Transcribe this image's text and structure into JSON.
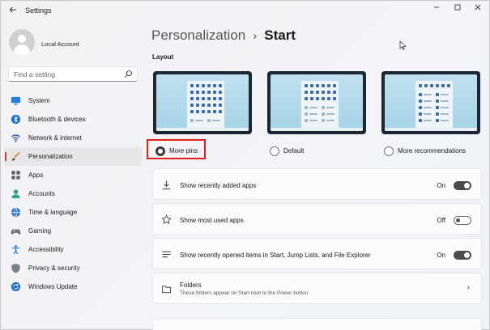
{
  "window": {
    "title": "Settings"
  },
  "titlebar": {
    "back_icon": "back-arrow-icon",
    "minimize": "minimize-icon",
    "maximize": "maximize-icon",
    "close": "close-icon"
  },
  "account": {
    "name": "Local Account"
  },
  "search": {
    "placeholder": "Find a setting"
  },
  "sidebar": {
    "items": [
      {
        "label": "System",
        "icon": "monitor-icon",
        "color": "#2b7bd3"
      },
      {
        "label": "Bluetooth & devices",
        "icon": "bluetooth-icon",
        "color": "#1e73c8"
      },
      {
        "label": "Network & internet",
        "icon": "wifi-icon",
        "color": "#2b5aa0"
      },
      {
        "label": "Personalization",
        "icon": "paintbrush-icon",
        "color": "#d08a3c",
        "active": true
      },
      {
        "label": "Apps",
        "icon": "apps-icon",
        "color": "#555a66"
      },
      {
        "label": "Accounts",
        "icon": "person-icon",
        "color": "#2aa38a"
      },
      {
        "label": "Time & language",
        "icon": "globe-clock-icon",
        "color": "#2a7bd0"
      },
      {
        "label": "Gaming",
        "icon": "gamepad-icon",
        "color": "#6b6f78"
      },
      {
        "label": "Accessibility",
        "icon": "accessibility-icon",
        "color": "#2b7bd3"
      },
      {
        "label": "Privacy & security",
        "icon": "shield-icon",
        "color": "#7a7f88"
      },
      {
        "label": "Windows Update",
        "icon": "update-icon",
        "color": "#1f6fc4"
      }
    ]
  },
  "breadcrumb": {
    "parent": "Personalization",
    "separator": "›",
    "current": "Start"
  },
  "layout": {
    "label": "Layout",
    "options": [
      {
        "label": "More pins",
        "selected": true
      },
      {
        "label": "Default",
        "selected": false
      },
      {
        "label": "More recommendations",
        "selected": false
      }
    ]
  },
  "settings": [
    {
      "label": "Show recently added apps",
      "icon": "download-icon",
      "state": "On",
      "on": true
    },
    {
      "label": "Show most used apps",
      "icon": "star-icon",
      "state": "Off",
      "on": false
    },
    {
      "label": "Show recently opened items in Start, Jump Lists, and File Explorer",
      "icon": "list-icon",
      "state": "On",
      "on": true
    },
    {
      "label": "Folders",
      "sub": "These folders appear on Start next to the Power button",
      "icon": "folder-icon",
      "chevron": "›"
    }
  ],
  "colors": {
    "accent": "#c0393b",
    "highlight": "#e0201a"
  }
}
